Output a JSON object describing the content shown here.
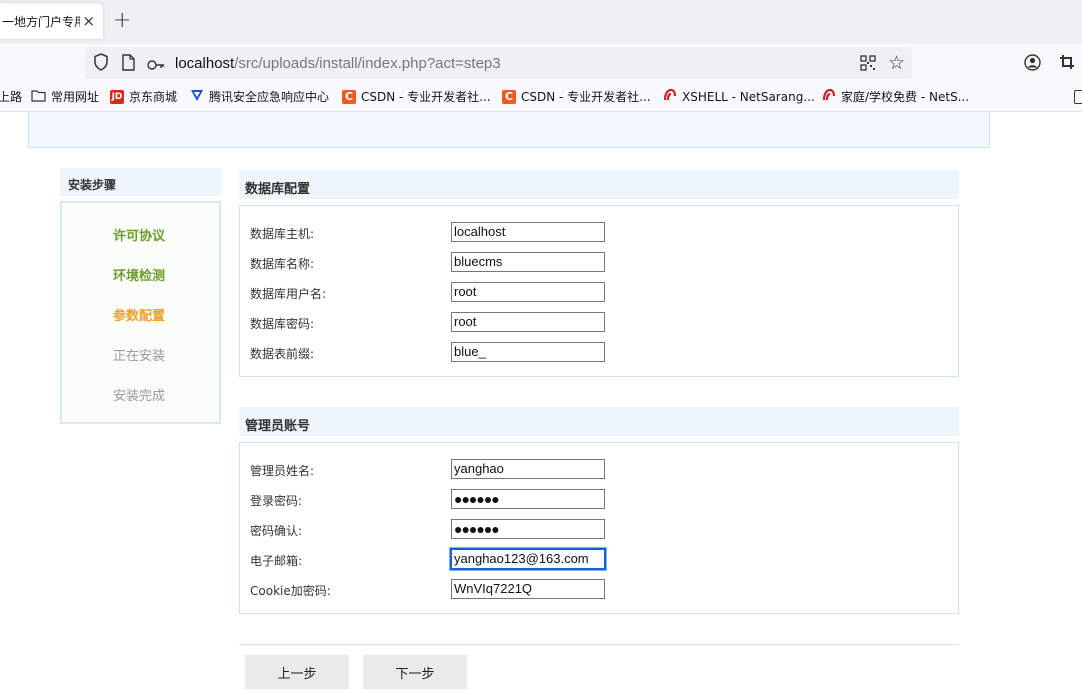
{
  "browser": {
    "tab_title": "一地方门户专用",
    "tab_close_icon": "×",
    "new_tab_icon": "+",
    "url_host": "localhost",
    "url_path": "/src/uploads/install/index.php?act=step3"
  },
  "bookmarks": [
    {
      "label": "上路",
      "icon": "folder-icon"
    },
    {
      "label": "常用网址",
      "icon": "folder-icon"
    },
    {
      "label": "京东商城",
      "icon": "jd-icon",
      "badge": "JD",
      "color": "#e1251b"
    },
    {
      "label": "腾讯安全应急响应中心",
      "icon": "tencent-icon",
      "color": "#1a4ecb"
    },
    {
      "label": "CSDN - 专业开发者社...",
      "icon": "csdn-icon",
      "badge": "C",
      "color": "#f05a22"
    },
    {
      "label": "CSDN - 专业开发者社...",
      "icon": "csdn-icon",
      "badge": "C",
      "color": "#f05a22"
    },
    {
      "label": "XSHELL - NetSarang...",
      "icon": "netsarang-icon",
      "color": "#d0202e"
    },
    {
      "label": "家庭/学校免费 - NetS...",
      "icon": "netsarang-icon",
      "color": "#d0202e"
    }
  ],
  "sidebar": {
    "title": "安装步骤",
    "steps": [
      {
        "label": "许可协议",
        "state": "done"
      },
      {
        "label": "环境检测",
        "state": "done"
      },
      {
        "label": "参数配置",
        "state": "current"
      },
      {
        "label": "正在安装",
        "state": "todo"
      },
      {
        "label": "安装完成",
        "state": "todo"
      }
    ]
  },
  "db": {
    "title": "数据库配置",
    "fields": [
      {
        "label": "数据库主机:",
        "value": "localhost"
      },
      {
        "label": "数据库名称:",
        "value": "bluecms"
      },
      {
        "label": "数据库用户名:",
        "value": "root"
      },
      {
        "label": "数据库密码:",
        "value": "root"
      },
      {
        "label": "数据表前缀:",
        "value": "blue_"
      }
    ]
  },
  "admin": {
    "title": "管理员账号",
    "fields": [
      {
        "label": "管理员姓名:",
        "value": "yanghao"
      },
      {
        "label": "登录密码:",
        "value": "●●●●●●"
      },
      {
        "label": "密码确认:",
        "value": "●●●●●●"
      },
      {
        "label": "电子邮箱:",
        "value": "yanghao123@163.com"
      },
      {
        "label": "Cookie加密码:",
        "value": "WnVIq7221Q"
      }
    ]
  },
  "buttons": {
    "prev": "上一步",
    "next": "下一步"
  },
  "colors": {
    "step_done": "#6d9d2e",
    "step_current": "#f0a030",
    "step_todo": "#999999",
    "focus_border": "#1560d6"
  }
}
